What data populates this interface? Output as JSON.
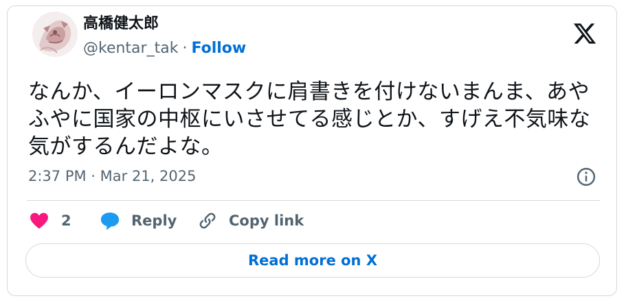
{
  "author": {
    "display_name": "高橋健太郎",
    "handle": "@kentar_tak",
    "separator": "·",
    "follow_label": "Follow"
  },
  "tweet": {
    "text": "なんか、イーロンマスクに肩書きを付けないまんま、あやふやに国家の中枢にいさせてる感じとか、すげえ不気味な気がするんだよな。",
    "timestamp": "2:37 PM · Mar 21, 2025"
  },
  "actions": {
    "like_count": "2",
    "reply_label": "Reply",
    "copy_link_label": "Copy link"
  },
  "read_more_label": "Read more on X",
  "colors": {
    "text": "#0f1419",
    "secondary": "#536471",
    "link": "#006fd6",
    "heart": "#f91880",
    "reply_icon": "#1d9bf0",
    "border": "#cfd9de"
  },
  "icons": {
    "brand": "x-logo-icon",
    "info": "info-icon",
    "like": "heart-icon",
    "reply": "speech-bubble-icon",
    "copy_link": "link-icon"
  }
}
